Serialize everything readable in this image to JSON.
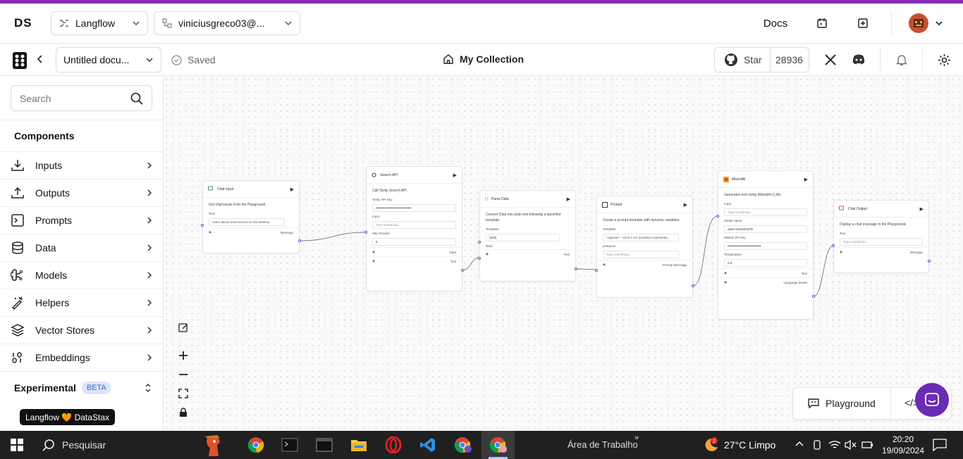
{
  "header": {
    "logo": "DS",
    "org_select": "Langflow",
    "project_select": "viniciusgreco03@...",
    "docs": "Docs"
  },
  "toolbar": {
    "doc_name": "Untitled docu...",
    "saved": "Saved",
    "collection": "My Collection",
    "star": "Star",
    "star_count": "28936"
  },
  "sidebar": {
    "search_placeholder": "Search",
    "components_title": "Components",
    "categories": [
      {
        "label": "Inputs",
        "icon": "download-icon"
      },
      {
        "label": "Outputs",
        "icon": "upload-icon"
      },
      {
        "label": "Prompts",
        "icon": "terminal-icon"
      },
      {
        "label": "Data",
        "icon": "database-icon"
      },
      {
        "label": "Models",
        "icon": "brain-icon"
      },
      {
        "label": "Helpers",
        "icon": "wand-icon"
      },
      {
        "label": "Vector Stores",
        "icon": "layers-icon"
      },
      {
        "label": "Embeddings",
        "icon": "binary-icon"
      }
    ],
    "experimental": "Experimental",
    "beta": "BETA",
    "badge": "Langflow 🧡 DataStax"
  },
  "nodes": {
    "chat_input": {
      "title": "Chat Input",
      "desc": "Get chat inputs from the Playground.",
      "field_label": "Text",
      "field_value": "como deixar tema escuro no dm detetiva",
      "output": "Message"
    },
    "search_api": {
      "title": "Search API",
      "desc": "Call Tavily Search API.",
      "key_label": "Tavily API Key",
      "key_value": "••••••••••••••••••••••••••••••••",
      "input_label": "Input",
      "input_placeholder": "Type something...",
      "max_label": "Max Results",
      "max_value": "5",
      "out_data": "Data",
      "out_tool": "Tool"
    },
    "parse_data": {
      "title": "Parse Data",
      "desc": "Convert Data into plain text following a specified template.",
      "template_label": "Template",
      "template_value": "{text}",
      "data_label": "Data",
      "output": "Text"
    },
    "prompt": {
      "title": "Prompt",
      "desc": "Create a prompt template with dynamic variables.",
      "template_label": "Template",
      "template_value": "<agente> - Você é um {condicto especiente...",
      "var_label": "pesquisa",
      "var_placeholder": "Type something...",
      "output": "Prompt Message"
    },
    "mistral": {
      "title": "MistralAI",
      "desc": "Generates text using MistralAI LLMs.",
      "input_label": "Input",
      "input_placeholder": "Type something...",
      "model_label": "Model Name",
      "model_value": "open-mistral-8x7b",
      "key_label": "Mistral API Key",
      "key_value": "••••••••••••••••••••••••••••••",
      "temp_label": "Temperature",
      "temp_value": "0.5",
      "out_text": "Text",
      "out_model": "Language Model"
    },
    "chat_output": {
      "title": "Chat Output",
      "desc": "Display a chat message in the Playground.",
      "field_label": "Text",
      "field_placeholder": "Type something...",
      "output": "Message"
    }
  },
  "playground": {
    "label": "Playground",
    "api": "</>"
  },
  "taskbar": {
    "search": "Pesquisar",
    "desktop": "Área de Trabalho",
    "weather": "27°C  Limpo",
    "time": "20:20",
    "date": "19/09/2024"
  },
  "colors": {
    "accent": "#8a2db0",
    "handle": "#4b5bd8",
    "taskbar": "#202020"
  }
}
